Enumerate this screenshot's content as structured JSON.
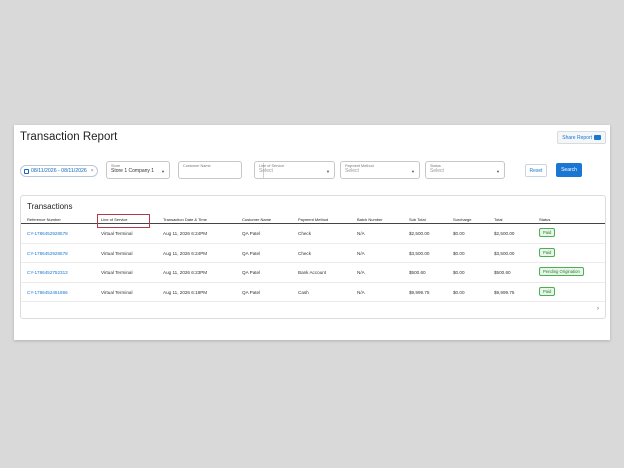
{
  "page": {
    "title": "Transaction Report",
    "share_label": "Share Report"
  },
  "filters": {
    "date_range": "08/11/2026 - 08/11/2026",
    "store": {
      "label": "Store",
      "value": "Store 1 Company 1"
    },
    "customer_name": {
      "label": "Customer Name",
      "value": ""
    },
    "line_of_service": {
      "label": "Line of Service",
      "placeholder": "Select"
    },
    "payment_method": {
      "label": "Payment Method",
      "placeholder": "Select"
    },
    "status": {
      "label": "Status",
      "placeholder": "Select"
    },
    "reset_label": "Reset",
    "search_label": "Search"
  },
  "transactions": {
    "title": "Transactions",
    "columns": [
      "Reference Number",
      "Line of Service",
      "Transaction Date & Time",
      "Customer Name",
      "Payment Method",
      "Batch Number",
      "Sub Total",
      "Surcharge",
      "Total",
      "Status"
    ],
    "rows": [
      {
        "ref": "CY-1786452928578",
        "service": "Virtual Terminal",
        "datetime": "Aug 11, 2026 6:24PM",
        "customer": "QA Patel",
        "method": "Check",
        "batch": "N/A",
        "subtotal": "$2,500.00",
        "surcharge": "$0.00",
        "total": "$2,500.00",
        "status": "Paid"
      },
      {
        "ref": "CY-1786452928578",
        "service": "Virtual Terminal",
        "datetime": "Aug 11, 2026 6:24PM",
        "customer": "QA Patel",
        "method": "Check",
        "batch": "N/A",
        "subtotal": "$3,500.00",
        "surcharge": "$0.00",
        "total": "$3,500.00",
        "status": "Paid"
      },
      {
        "ref": "CY-1786452752313",
        "service": "Virtual Terminal",
        "datetime": "Aug 11, 2026 6:23PM",
        "customer": "QA Patel",
        "method": "Bank Account",
        "batch": "N/A",
        "subtotal": "$500.60",
        "surcharge": "$0.00",
        "total": "$500.60",
        "status": "Pending Origination"
      },
      {
        "ref": "CY-1786452461866",
        "service": "Virtual Terminal",
        "datetime": "Aug 11, 2026 6:18PM",
        "customer": "QA Patel",
        "method": "Cash",
        "batch": "N/A",
        "subtotal": "$9,999.75",
        "surcharge": "$0.00",
        "total": "$9,999.75",
        "status": "Paid"
      }
    ],
    "next_page_glyph": "›"
  },
  "colors": {
    "accent": "#1976d2",
    "highlight": "#b33a4a",
    "badge_green": "#2e7d32"
  }
}
